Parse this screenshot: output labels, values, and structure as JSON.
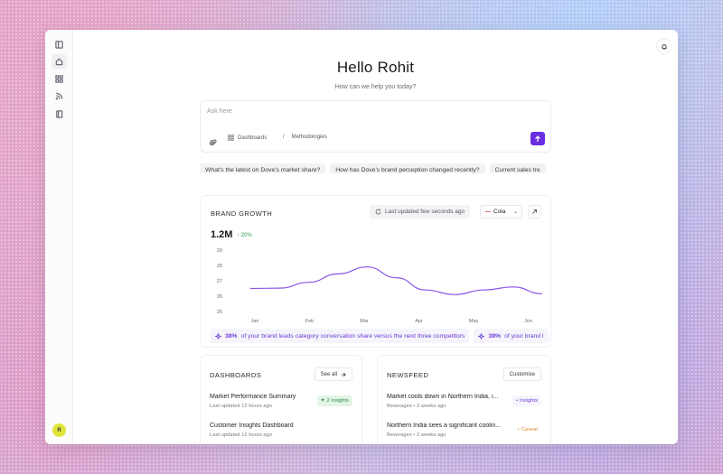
{
  "greeting": {
    "title": "Hello Rohit",
    "subtitle": "How can we help you today?"
  },
  "ask": {
    "placeholder": "Ask here",
    "sources": [
      "Dashboards",
      "Methodologies"
    ],
    "separator": "/"
  },
  "suggestions": [
    "What's the latest on Dove's market share?",
    "How has Dove's brand perception changed recently?",
    "Current sales tre"
  ],
  "brand_growth": {
    "title": "BRAND GROWTH",
    "updated": "Last updated few seconds ago",
    "brand": "Cola",
    "value": "1.2M",
    "delta": "20%",
    "insights": [
      {
        "pct": "38%",
        "text": "of your brand leads category conversation share versus the next three competitors"
      },
      {
        "pct": "38%",
        "text": "of your brand l"
      }
    ]
  },
  "chart_data": {
    "type": "line",
    "x": [
      "Jan",
      "Feb",
      "Mar",
      "Apr",
      "May",
      "Jun"
    ],
    "y_ticks": [
      29,
      28,
      27,
      26,
      25
    ],
    "ylim": [
      25,
      29
    ],
    "points": [
      [
        "Jan",
        26.5
      ],
      [
        "Jan",
        26.52
      ],
      [
        "Feb",
        26.9
      ],
      [
        "Feb",
        27.45
      ],
      [
        "Mar",
        27.9
      ],
      [
        "Mar",
        27.2
      ],
      [
        "Apr",
        26.4
      ],
      [
        "Apr",
        26.1
      ],
      [
        "May",
        26.4
      ],
      [
        "May",
        26.6
      ],
      [
        "Jun",
        26.15
      ]
    ],
    "values": [
      26.5,
      26.9,
      27.9,
      26.1,
      26.6,
      26.1
    ],
    "color": "#8a55e8"
  },
  "dashboards": {
    "title": "DASHBOARDS",
    "see_all": "See all",
    "items": [
      {
        "title": "Market Performance Summary",
        "meta": "Last updated 12 hours ago",
        "tag": "2 insights"
      },
      {
        "title": "Customer Insights Dashboard",
        "meta": "Last updated 12 hours ago",
        "tag": ""
      }
    ]
  },
  "newsfeed": {
    "title": "NEWSFEED",
    "customise": "Customise",
    "items": [
      {
        "title": "Market cools down in Northern India, i...",
        "meta": "Beverages • 2 weeks ago",
        "tag": "Insights"
      },
      {
        "title": "Northern India sees a significant coolin...",
        "meta": "Beverages • 2 weeks ago",
        "tag": "Caveat"
      }
    ]
  },
  "user": {
    "initial": "R"
  },
  "colors": {
    "accent": "#6a2fe0",
    "positive": "#2f9a52",
    "insight": "#6a3ad6"
  }
}
